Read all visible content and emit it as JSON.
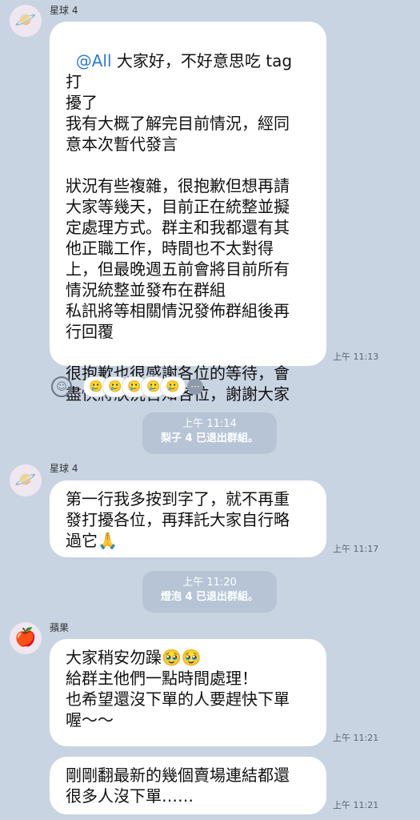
{
  "chat": {
    "messages": [
      {
        "sender": "星球 4",
        "avatar_icon": "planet-icon",
        "text_parts": [
          {
            "mention": "@All"
          },
          {
            "text": " 大家好，不好意思吃 tag 打\n擾了\n我有大概了解完目前情況，經同\n意本次暫代發言\n\n狀況有些複雜，很抱歉但想再請\n大家等幾天，目前正在統整並擬\n定處理方式。群主和我都還有其\n他正職工作，時間也不太對得\n上，但最晚週五前會將目前所有\n情況統整並發布在群組\n私訊將等相關情況發佈群組後再\n行回覆\n\n很抱歉也很感謝各位的等待，會\n盡快將狀況告知各位，謝謝大家"
          }
        ],
        "time": "上午 11:13"
      },
      {
        "system_time": "上午 11:14",
        "system_text": "梨子 4 已退出群組。",
        "system_name": "梨子 4"
      },
      {
        "sender": "星球 4",
        "avatar_icon": "planet-icon",
        "text": "第一行我多按到字了，就不再重\n發打擾各位，再拜託大家自行略\n過它🙏",
        "time": "上午 11:17"
      },
      {
        "system_time": "上午 11:20",
        "system_text": "燈泡 4 已退出群組。",
        "system_name": "燈泡 4"
      },
      {
        "sender": "蘋果",
        "avatar_icon": "apple-icon",
        "text": "大家稍安勿躁🥹🥹\n給群主他們一點時間處理！\n也希望還沒下單的人要趕快下單\n喔～～",
        "time": "上午 11:21"
      },
      {
        "sender": "蘋果",
        "text": "剛剛翻最新的幾個賣場連結都還\n很多人沒下單……",
        "time": "上午 11:21"
      }
    ],
    "reactions": {
      "count_icons": 5,
      "more_label": "···"
    }
  }
}
